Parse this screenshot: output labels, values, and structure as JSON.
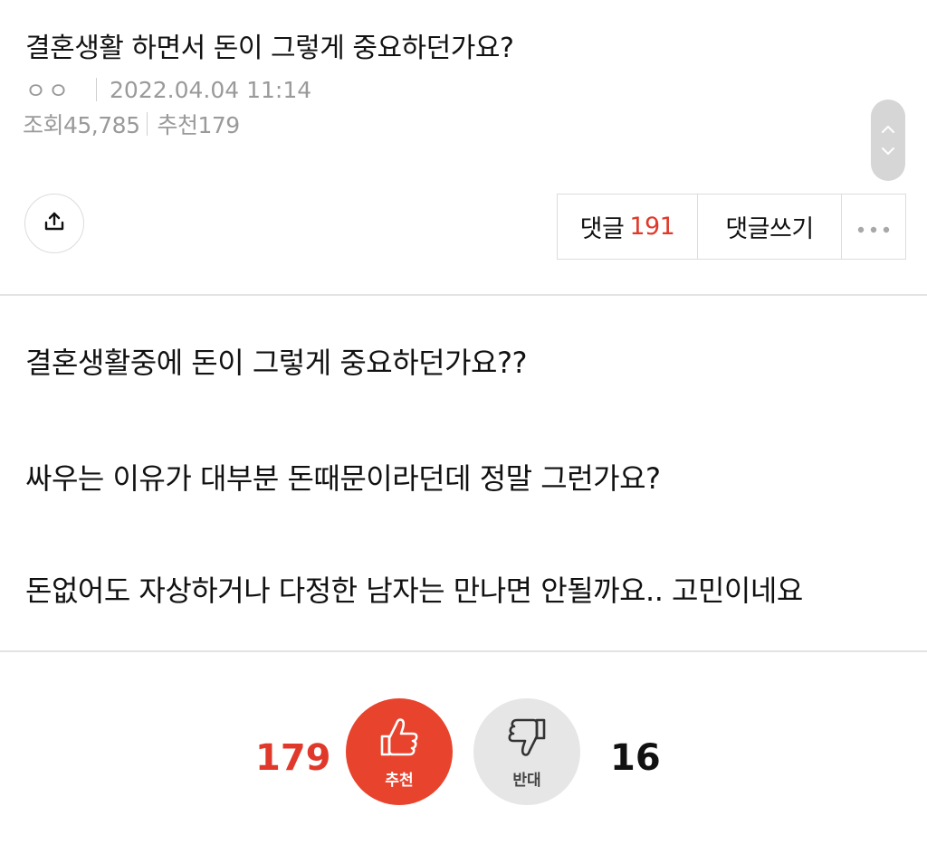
{
  "post": {
    "title": "결혼생활 하면서 돈이 그렇게 중요하던가요?",
    "author": "ㅇㅇ",
    "date": "2022.04.04 11:14",
    "views_text": "조회45,785",
    "recommend_text": "추천179"
  },
  "actions": {
    "comments_label": "댓글",
    "comments_count": "191",
    "write_label": "댓글쓰기",
    "more_label": "•••"
  },
  "body": {
    "lines": [
      "결혼생활중에 돈이 그렇게 중요하던가요??",
      "싸우는 이유가 대부분 돈때문이라던데 정말 그런가요?",
      "돈없어도 자상하거나 다정한 남자는 만나면 안될까요.. 고민이네요"
    ]
  },
  "votes": {
    "up_count": "179",
    "up_label": "추천",
    "down_count": "16",
    "down_label": "반대"
  },
  "icons": {
    "share": "share-icon",
    "scroll_up": "chevron-up-icon",
    "scroll_down": "chevron-down-icon",
    "thumbs_up": "thumbs-up-icon",
    "thumbs_down": "thumbs-down-icon"
  },
  "colors": {
    "accent_red": "#e8432d",
    "count_red": "#e0392b",
    "meta_gray": "#9a9a9a"
  }
}
